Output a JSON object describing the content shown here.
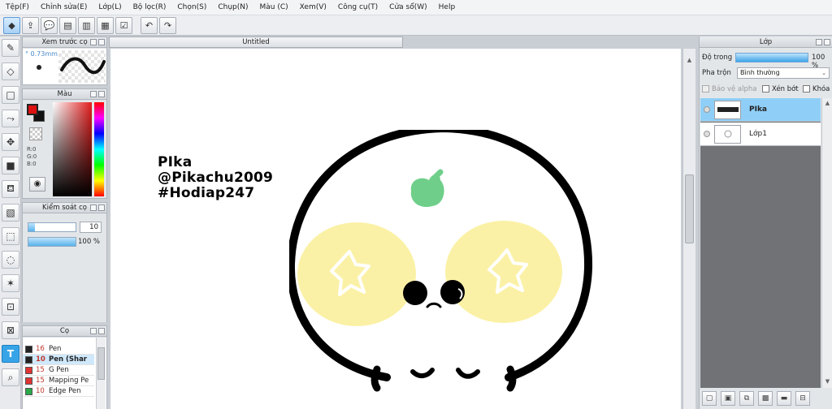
{
  "menu": [
    "Tệp(F)",
    "Chỉnh sửa(E)",
    "Lớp(L)",
    "Bộ lọc(R)",
    "Chọn(S)",
    "Chụp(N)",
    "Màu (C)",
    "Xem(V)",
    "Công cụ(T)",
    "Cửa sổ(W)",
    "Help"
  ],
  "toolbar_icons": [
    "selection-mode-icon",
    "export-icon",
    "speech-icon",
    "comment-icon",
    "page-icon",
    "layout-icon",
    "check-list-icon",
    "undo-icon",
    "redo-icon"
  ],
  "tool_icons": [
    "brush-tool-icon",
    "eraser-tool-icon",
    "rect-select-tool-icon",
    "vector-tool-icon",
    "move-tool-icon",
    "fill-rect-tool-icon",
    "bucket-tool-icon",
    "gradient-tool-icon",
    "marquee-tool-icon",
    "lasso-tool-icon",
    "magic-wand-tool-icon",
    "select-pen-tool-icon",
    "select-eraser-tool-icon",
    "text-tool-icon",
    "eyedropper-tool-icon"
  ],
  "brush_preview": {
    "title": "Xem trước cọ",
    "size": "° 0.73mm"
  },
  "color_panel": {
    "title": "Màu",
    "r": "R:0",
    "g": "G:0",
    "b": "B:0",
    "fg_color": "#d11111",
    "bg_color": "#111111"
  },
  "brush_control": {
    "title": "Kiểm soát cọ",
    "size": "10",
    "opacity": "100 %",
    "size_fraction": 0.14,
    "opacity_fraction": 1.0
  },
  "brush_list": {
    "title": "Cọ",
    "items": [
      {
        "size": "16",
        "name": "Pen",
        "color": "#222222"
      },
      {
        "size": "10",
        "name": "Pen (Shar",
        "color": "#222222",
        "selected": true
      },
      {
        "size": "15",
        "name": "G Pen",
        "color": "#e03434"
      },
      {
        "size": "15",
        "name": "Mapping Pe",
        "color": "#e03434"
      },
      {
        "size": "10",
        "name": "Edge Pen",
        "color": "#2aa84a"
      }
    ]
  },
  "document": {
    "tab": "Untitled"
  },
  "artwork": {
    "text_lines": [
      "PIka",
      "@Pikachu2009",
      "#Hodiap247"
    ]
  },
  "layer_panel": {
    "title": "Lớp",
    "opacity_label": "Độ trong",
    "opacity_value": "100 %",
    "blend_label": "Pha trộn",
    "blend_value": "Bình thường",
    "protect_alpha": "Bảo vệ alpha",
    "clipping": "Xén bớt",
    "lock": "Khóa",
    "layers": [
      {
        "name": "PIka",
        "selected": true
      },
      {
        "name": "Lớp1",
        "selected": false
      }
    ]
  },
  "layer_footer_icons": [
    "new-layer-icon",
    "new-vector-layer-icon",
    "copy-layer-icon",
    "new-halftone-layer-icon",
    "new-folder-icon",
    "merge-layer-icon"
  ],
  "colors": {
    "accent": "#38a4e8",
    "selection": "#8fcff7",
    "cheek": "#fbf1a6",
    "leaf": "#6fcf8a"
  }
}
